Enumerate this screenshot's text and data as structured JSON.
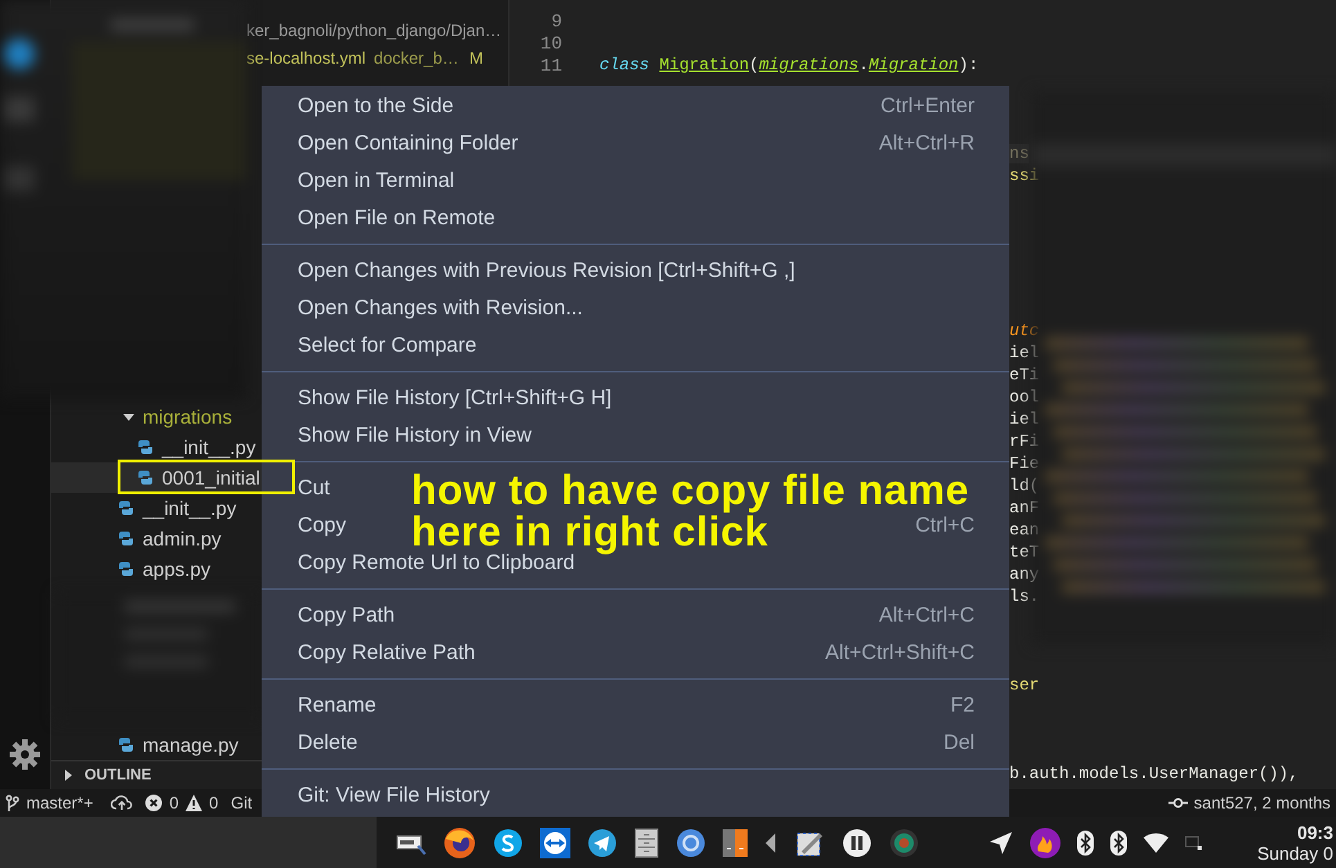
{
  "sidebar": {
    "open_editors": [
      {
        "description": "ker_bagnoli/python_django/Djan…",
        "modified": false
      },
      {
        "name": "se-localhost.yml",
        "description": "docker_b…",
        "status": "M",
        "modified": true
      }
    ],
    "tree": [
      {
        "name": "migrations",
        "kind": "folder",
        "expanded": true,
        "modified": true,
        "children": [
          {
            "name": "__init__.py",
            "kind": "file",
            "selected": false
          },
          {
            "name": "0001_initial",
            "kind": "file",
            "selected": true
          }
        ]
      },
      {
        "name": "__init__.py",
        "kind": "file",
        "selected": false
      },
      {
        "name": "admin.py",
        "kind": "file",
        "selected": false
      },
      {
        "name": "apps.py",
        "kind": "file",
        "selected": false
      },
      {
        "name": "manage.py",
        "kind": "file",
        "selected": false
      }
    ],
    "outline": {
      "title": "OUTLINE",
      "expanded": false
    }
  },
  "editor": {
    "lines": [
      {
        "number": "9"
      },
      {
        "number": "10"
      },
      {
        "number": "11",
        "tokens": [
          {
            "text": "class",
            "kind": "storage"
          },
          {
            "text": "Migration",
            "kind": "class"
          },
          {
            "text": "(",
            "kind": "plain"
          },
          {
            "text": "migrations",
            "kind": "inherited"
          },
          {
            "text": ".",
            "kind": "plain"
          },
          {
            "text": "Migration",
            "kind": "inherited"
          },
          {
            "text": "):",
            "kind": "plain"
          }
        ]
      }
    ],
    "fragments": [
      {
        "text": "ns",
        "kind": "muted"
      },
      {
        "text": "ssi",
        "kind": "string"
      },
      {
        "text": "utc",
        "kind": "param"
      },
      {
        "text": "iel",
        "kind": "plain"
      },
      {
        "text": "eTi",
        "kind": "plain"
      },
      {
        "text": "ool",
        "kind": "plain"
      },
      {
        "text": "iel",
        "kind": "plain"
      },
      {
        "text": "rFi",
        "kind": "plain"
      },
      {
        "text": "Fie",
        "kind": "plain"
      },
      {
        "text": "ld(",
        "kind": "plain"
      },
      {
        "text": "anF",
        "kind": "plain"
      },
      {
        "text": "ean",
        "kind": "plain"
      },
      {
        "text": "teT",
        "kind": "plain"
      },
      {
        "text": "any",
        "kind": "plain"
      },
      {
        "text": "ls.",
        "kind": "plain"
      },
      {
        "text": "ser",
        "kind": "string"
      },
      {
        "text": "b.auth.models.UserManager()),",
        "kind": "plain"
      }
    ]
  },
  "context_menu": {
    "groups": [
      {
        "items": [
          {
            "label": "Open to the Side",
            "shortcut": "Ctrl+Enter"
          },
          {
            "label": "Open Containing Folder",
            "shortcut": "Alt+Ctrl+R"
          },
          {
            "label": "Open in Terminal"
          },
          {
            "label": "Open File on Remote"
          }
        ]
      },
      {
        "items": [
          {
            "label": "Open Changes with Previous Revision [Ctrl+Shift+G ,]"
          },
          {
            "label": "Open Changes with Revision..."
          },
          {
            "label": "Select for Compare"
          }
        ]
      },
      {
        "items": [
          {
            "label": "Show File History [Ctrl+Shift+G H]"
          },
          {
            "label": "Show File History in View"
          }
        ]
      },
      {
        "items": [
          {
            "label": "Cut"
          },
          {
            "label": "Copy",
            "shortcut": "Ctrl+C"
          },
          {
            "label": "Copy Remote Url to Clipboard"
          }
        ]
      },
      {
        "items": [
          {
            "label": "Copy Path",
            "shortcut": "Alt+Ctrl+C"
          },
          {
            "label": "Copy Relative Path",
            "shortcut": "Alt+Ctrl+Shift+C"
          }
        ]
      },
      {
        "items": [
          {
            "label": "Rename",
            "shortcut": "F2"
          },
          {
            "label": "Delete",
            "shortcut": "Del"
          }
        ]
      },
      {
        "items": [
          {
            "label": "Git: View File History"
          }
        ]
      }
    ]
  },
  "annotation": {
    "lines": [
      "how to have copy file name",
      "here in right click"
    ]
  },
  "status_bar": {
    "branch": "master*+",
    "errors": "0",
    "warnings": "0",
    "git": "Git",
    "blame": "sant527, 2 months"
  },
  "taskbar": {
    "time": "09:3",
    "date": "Sunday 0"
  }
}
